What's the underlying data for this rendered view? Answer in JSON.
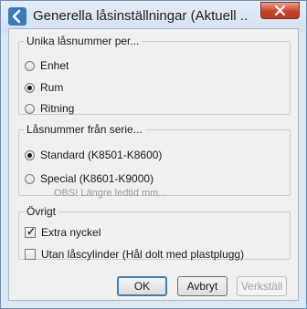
{
  "window": {
    "title": "Generella låsinställningar (Aktuell ..."
  },
  "group_unique": {
    "legend": "Unika låsnummer per...",
    "options": [
      {
        "label": "Enhet",
        "checked": false
      },
      {
        "label": "Rum",
        "checked": true
      },
      {
        "label": "Ritning",
        "checked": false
      }
    ]
  },
  "group_series": {
    "legend": "Låsnummer från serie...",
    "options": [
      {
        "label": "Standard (K8501-K8600)",
        "checked": true
      },
      {
        "label": "Special (K8601-K9000)",
        "checked": false
      }
    ],
    "note": "OBS! Längre ledtid mm..."
  },
  "group_other": {
    "legend": "Övrigt",
    "options": [
      {
        "label": "Extra nyckel",
        "checked": true
      },
      {
        "label": "Utan låscylinder (Hål dolt med plastplugg)",
        "checked": false
      }
    ]
  },
  "buttons": {
    "ok": "OK",
    "cancel": "Avbryt",
    "apply": "Verkställ"
  },
  "icons": {
    "app": "app-back-icon",
    "close": "close-icon"
  }
}
